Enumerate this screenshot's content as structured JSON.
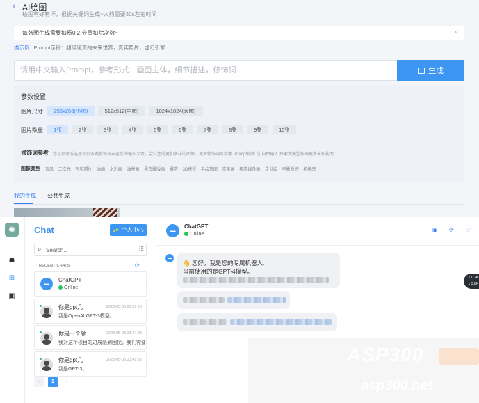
{
  "drawing": {
    "back_icon": "chevron-left-icon",
    "title": "AI绘图",
    "subtitle": "绘图有好有坏，根据关键词生成~大约需要30s左右时间",
    "notice": "每张图生成需要扣费0.2,会员扣除次数~",
    "notice_close": "×",
    "example_link": "换示例",
    "example_text": "Prompt示例：超级逼真的未来世界，真实照片，虚幻引擎",
    "prompt_placeholder": "请用中文输入Prompt，参考形式：画面主体，细节描述，修饰词",
    "generate_label": "生成",
    "settings_title": "参数设置",
    "size_label": "图片尺寸:",
    "sizes": [
      "256x256(小图)",
      "512x512(中图)",
      "1024x1024(大图)"
    ],
    "selected_size": "256x256(小图)",
    "count_label": "图片数量:",
    "counts": [
      "1张",
      "2张",
      "3张",
      "4张",
      "5张",
      "6张",
      "7张",
      "8张",
      "9张",
      "10张"
    ],
    "selected_count": "1张",
    "modifier_title": "修饰词参考",
    "modifier_desc": "您可参考或选用下列各类修饰词丰富您的输入文本，尝试生成更加多样的图像，更多修饰词可参考 Prompt指南 或 自由输入 探索大模型作画更多未知能力",
    "style_label": "图像类型",
    "styles": [
      "古风",
      "二次元",
      "写实照片",
      "油画",
      "水彩画",
      "油墨画",
      "黑白雕版画",
      "雕塑",
      "3D模型",
      "手绘草图",
      "炭笔画",
      "极简线条画",
      "浮世绘",
      "电影质感",
      "机械感"
    ],
    "tabs": [
      "我的生成",
      "公共生成"
    ],
    "active_tab": "我的生成"
  },
  "chat": {
    "logo_icon": "openai-logo-icon",
    "rail_icons": [
      "robot-icon",
      "plus-square-icon",
      "image-icon"
    ],
    "title": "Chat",
    "center_button": "✨ 个人中心",
    "search_placeholder": "Search...",
    "recent_label": "RECENT CHATS",
    "conversations": [
      {
        "name": "ChatGPT",
        "status": "Online",
        "avatar": "bot"
      },
      {
        "name": "你是gpt几",
        "time": "2023-05-03 23:57:28",
        "message": "我是OpenAI GPT-3模型。",
        "avatar": "user"
      },
      {
        "name": "你是一个领...",
        "time": "2023-05-03 23:44:43",
        "message": "我对这个项目的进展感到困扰。我们需要",
        "avatar": "user"
      },
      {
        "name": "你是gpt几",
        "time": "2023-05-03 23:41:52",
        "message": "我是GPT-3。",
        "avatar": "user"
      }
    ],
    "pager": {
      "prev": "‹",
      "current": "1",
      "next": "›"
    },
    "header": {
      "name": "ChatGPT",
      "status": "Online"
    },
    "header_tools": [
      "save-icon",
      "refresh-icon",
      "heart-icon"
    ],
    "messages": {
      "first_line1": "👋 您好，我是您的专属机器人.",
      "first_line2": "当前使用的是GPT-4模型。"
    },
    "watermark": {
      "line1": "ASP300",
      "line2": "asp300.net"
    },
    "network": {
      "up": "↑ 0.2K",
      "down": "↓ 3.8K"
    }
  },
  "colors": {
    "accent": "#3c96f2",
    "online": "#22c55e",
    "panel_bg": "#f3f5f8"
  }
}
